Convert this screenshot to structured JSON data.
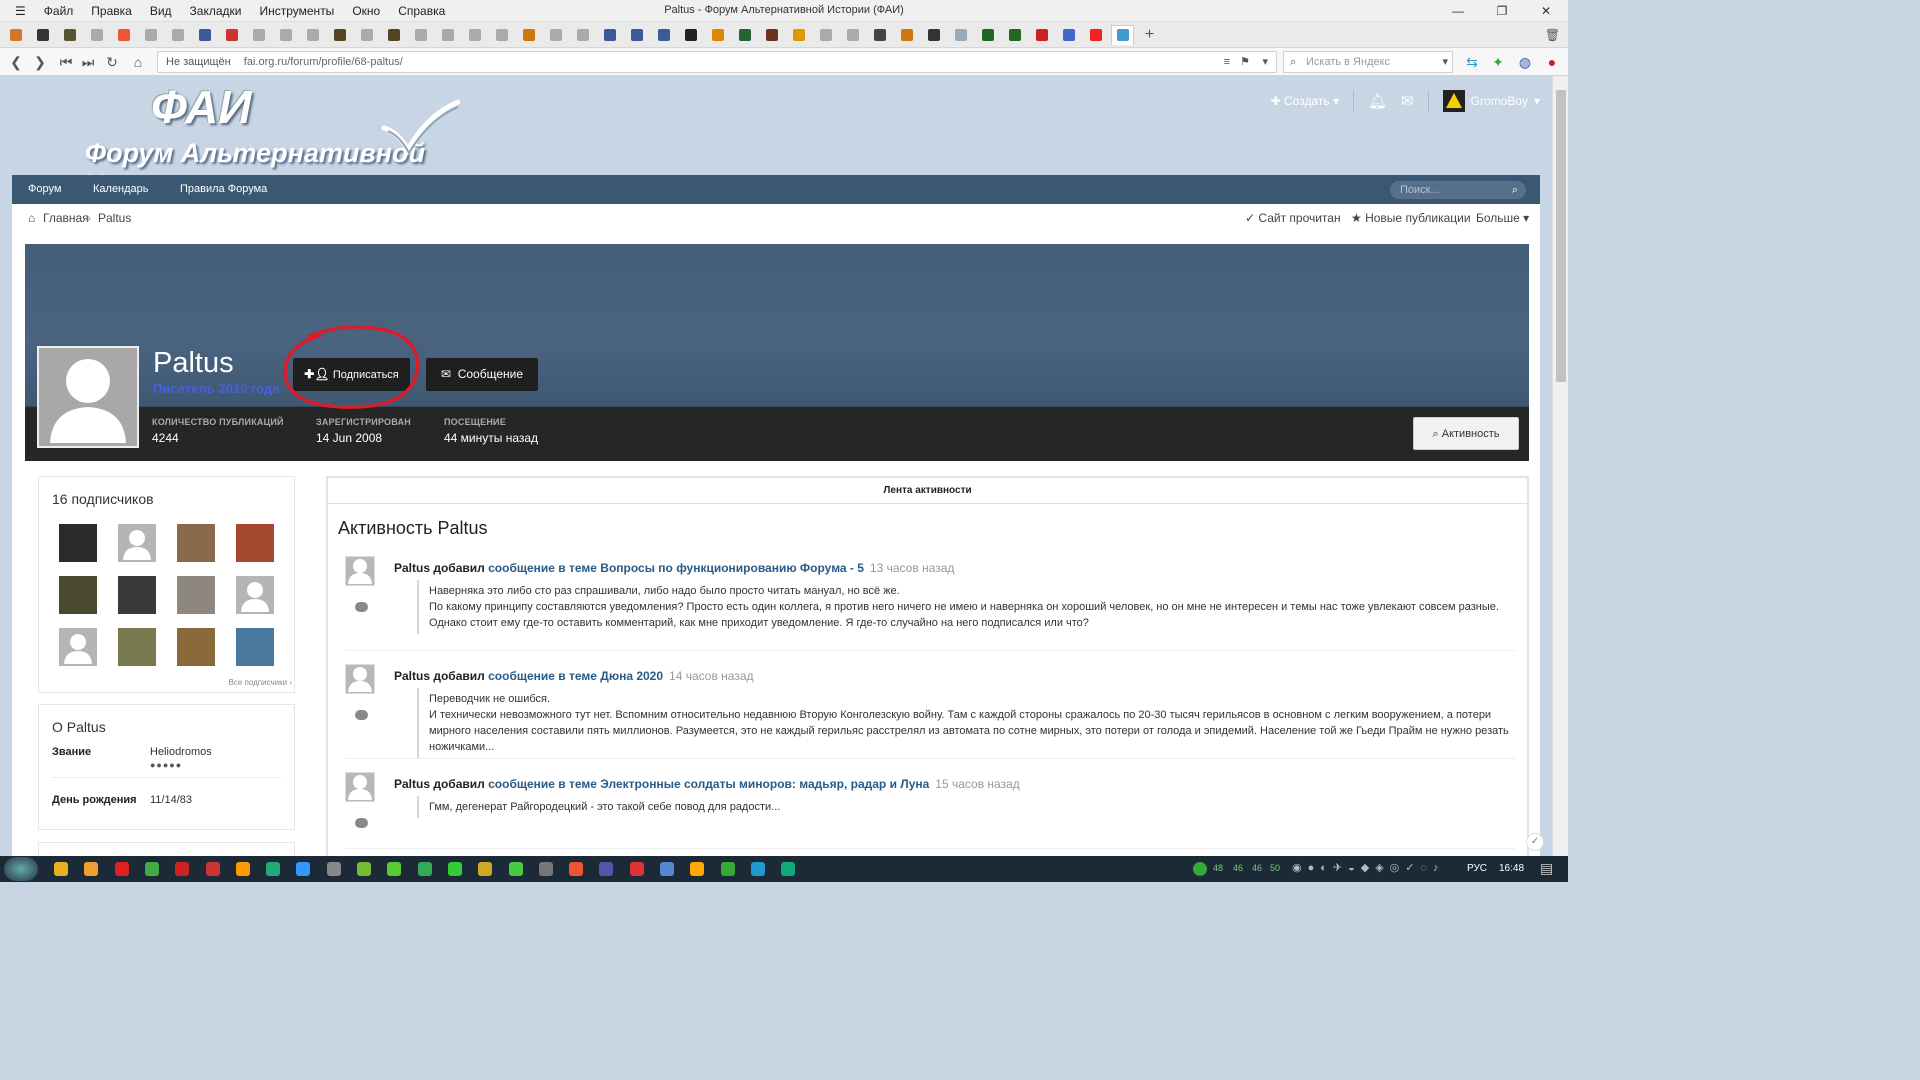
{
  "window": {
    "title": "Paltus - Форум Альтернативной Истории (ФАИ)",
    "menu": [
      "Файл",
      "Правка",
      "Вид",
      "Закладки",
      "Инструменты",
      "Окно",
      "Справка"
    ]
  },
  "tabs": [
    {
      "color": "#d2782b"
    },
    {
      "color": "#333"
    },
    {
      "color": "#553"
    },
    {
      "color": "#aaa"
    },
    {
      "color": "#e53"
    },
    {
      "color": "#aaa"
    },
    {
      "color": "#aaa"
    },
    {
      "color": "#3a5a9a"
    },
    {
      "color": "#c33"
    },
    {
      "color": "#aaa"
    },
    {
      "color": "#aaa"
    },
    {
      "color": "#aaa"
    },
    {
      "color": "#542"
    },
    {
      "color": "#aaa"
    },
    {
      "color": "#542"
    },
    {
      "color": "#aaa"
    },
    {
      "color": "#aaa"
    },
    {
      "color": "#aaa"
    },
    {
      "color": "#aaa"
    },
    {
      "color": "#c71"
    },
    {
      "color": "#aaa"
    },
    {
      "color": "#aaa"
    },
    {
      "color": "#3a5a9a"
    },
    {
      "color": "#3a5a9a"
    },
    {
      "color": "#3a5a9a"
    },
    {
      "color": "#222"
    },
    {
      "color": "#d80"
    },
    {
      "color": "#263"
    },
    {
      "color": "#632"
    },
    {
      "color": "#d90"
    },
    {
      "color": "#aaa"
    },
    {
      "color": "#aaa"
    },
    {
      "color": "#444"
    },
    {
      "color": "#c71"
    },
    {
      "color": "#333"
    },
    {
      "color": "#9ab"
    },
    {
      "color": "#262"
    },
    {
      "color": "#262"
    },
    {
      "color": "#c22"
    },
    {
      "color": "#46c"
    },
    {
      "color": "#e22"
    },
    {
      "color": "#49c",
      "active": true
    }
  ],
  "address": {
    "security": "Не защищён",
    "url": "fai.org.ru/forum/profile/68-paltus/",
    "search_placeholder": "Искать в Яндекс"
  },
  "site": {
    "logo_title": "ФАИ",
    "logo_subtitle": "Форум Альтернативной Истории",
    "create_label": "Создать",
    "username": "GromoBoy"
  },
  "nav": {
    "items": [
      "Форум",
      "Календарь",
      "Правила Форума"
    ],
    "search_placeholder": "Поиск..."
  },
  "breadcrumb": {
    "home": "Главная",
    "current": "Paltus",
    "mark_read": "Сайт прочитан",
    "new_posts": "Новые публикации",
    "more": "Больше"
  },
  "profile": {
    "name": "Paltus",
    "rank": "Писатель 2010 года",
    "follow_label": "Подписаться",
    "message_label": "Сообщение",
    "activity_label": "Активность",
    "stats": [
      {
        "label": "КОЛИЧЕСТВО ПУБЛИКАЦИЙ",
        "value": "4244"
      },
      {
        "label": "ЗАРЕГИСТРИРОВАН",
        "value": "14 Jun 2008"
      },
      {
        "label": "ПОСЕЩЕНИЕ",
        "value": "44 минуты назад"
      }
    ]
  },
  "followers": {
    "title": "16 подписчиков",
    "all_label": "Все подписчики",
    "thumbs": [
      {
        "color": "#2a2a2a"
      },
      {
        "color": "#b5b5b5"
      },
      {
        "color": "#8a6a4a"
      },
      {
        "color": "#a54a30"
      },
      {
        "color": "#4a4a30"
      },
      {
        "color": "#3a3a3a"
      },
      {
        "color": "#8d8780"
      },
      {
        "color": "#b5b5b5"
      },
      {
        "color": "#b5b5b5"
      },
      {
        "color": "#7a7a50"
      },
      {
        "color": "#8a6a3a"
      },
      {
        "color": "#4a7aa0"
      }
    ]
  },
  "about": {
    "title": "О Paltus",
    "rank_label": "Звание",
    "rank_value": "Heliodromos",
    "rank_dots": "●●●●●",
    "bday_label": "День рождения",
    "bday_value": "11/14/83"
  },
  "feed": {
    "tab_label": "Лента активности",
    "heading": "Активность Paltus",
    "items": [
      {
        "author_action": "Paltus добавил",
        "link": "сообщение в теме Вопросы по функционированию Форума - 5",
        "time": "13 часов назад",
        "text": "Наверняка это либо сто раз спрашивали, либо надо было просто читать мануал, но всё же.\nПо какому принципу составляются уведомления? Просто есть один коллега, я против него ничего не имею и наверняка он хороший человек, но он мне не интересен и темы нас тоже увлекают совсем разные. Однако стоит ему где-то оставить комментарий, как мне приходит уведомление. Я где-то случайно на него подписался или что?"
      },
      {
        "author_action": "Paltus добавил",
        "link": "сообщение в теме Дюна 2020",
        "time": "14 часов назад",
        "text": "Переводчик не ошибся.\nИ технически невозможного тут нет. Вспомним относительно недавнюю Вторую Конголезскую войну. Там с каждой стороны сражалось по 20-30 тысяч герильясов в основном с легким вооружением, а потери мирного населения составили пять миллионов. Разумеется, это не каждый герильяс расстрелял из автомата по сотне мирных, это потери от голода и эпидемий. Население той же Гьеди Прайм не нужно резать ножичками..."
      },
      {
        "author_action": "Paltus добавил",
        "link": "сообщение в теме Электронные солдаты миноров: мадьяр, радар и Луна",
        "time": "15 часов назад",
        "text": "Гмм, дегенерат Райгородецкий - это такой себе повод для радости..."
      }
    ]
  },
  "taskbar": {
    "tray_numbers": [
      "48",
      "46",
      "46",
      "50"
    ],
    "lang": "РУС",
    "time": "16:48",
    "apps": [
      {
        "color": "#e8b020"
      },
      {
        "color": "#f0a030"
      },
      {
        "color": "#d22"
      },
      {
        "color": "#4a4"
      },
      {
        "color": "#c22"
      },
      {
        "color": "#c33"
      },
      {
        "color": "#f90"
      },
      {
        "color": "#2a7"
      },
      {
        "color": "#39f"
      },
      {
        "color": "#888"
      },
      {
        "color": "#7b3"
      },
      {
        "color": "#5c3"
      },
      {
        "color": "#3a5"
      },
      {
        "color": "#3c3"
      },
      {
        "color": "#ca2"
      },
      {
        "color": "#4c4"
      },
      {
        "color": "#777"
      },
      {
        "color": "#e53"
      },
      {
        "color": "#55a"
      },
      {
        "color": "#d33"
      },
      {
        "color": "#58c"
      },
      {
        "color": "#fa0"
      },
      {
        "color": "#3a3"
      },
      {
        "color": "#29c"
      },
      {
        "color": "#1a7"
      }
    ]
  }
}
